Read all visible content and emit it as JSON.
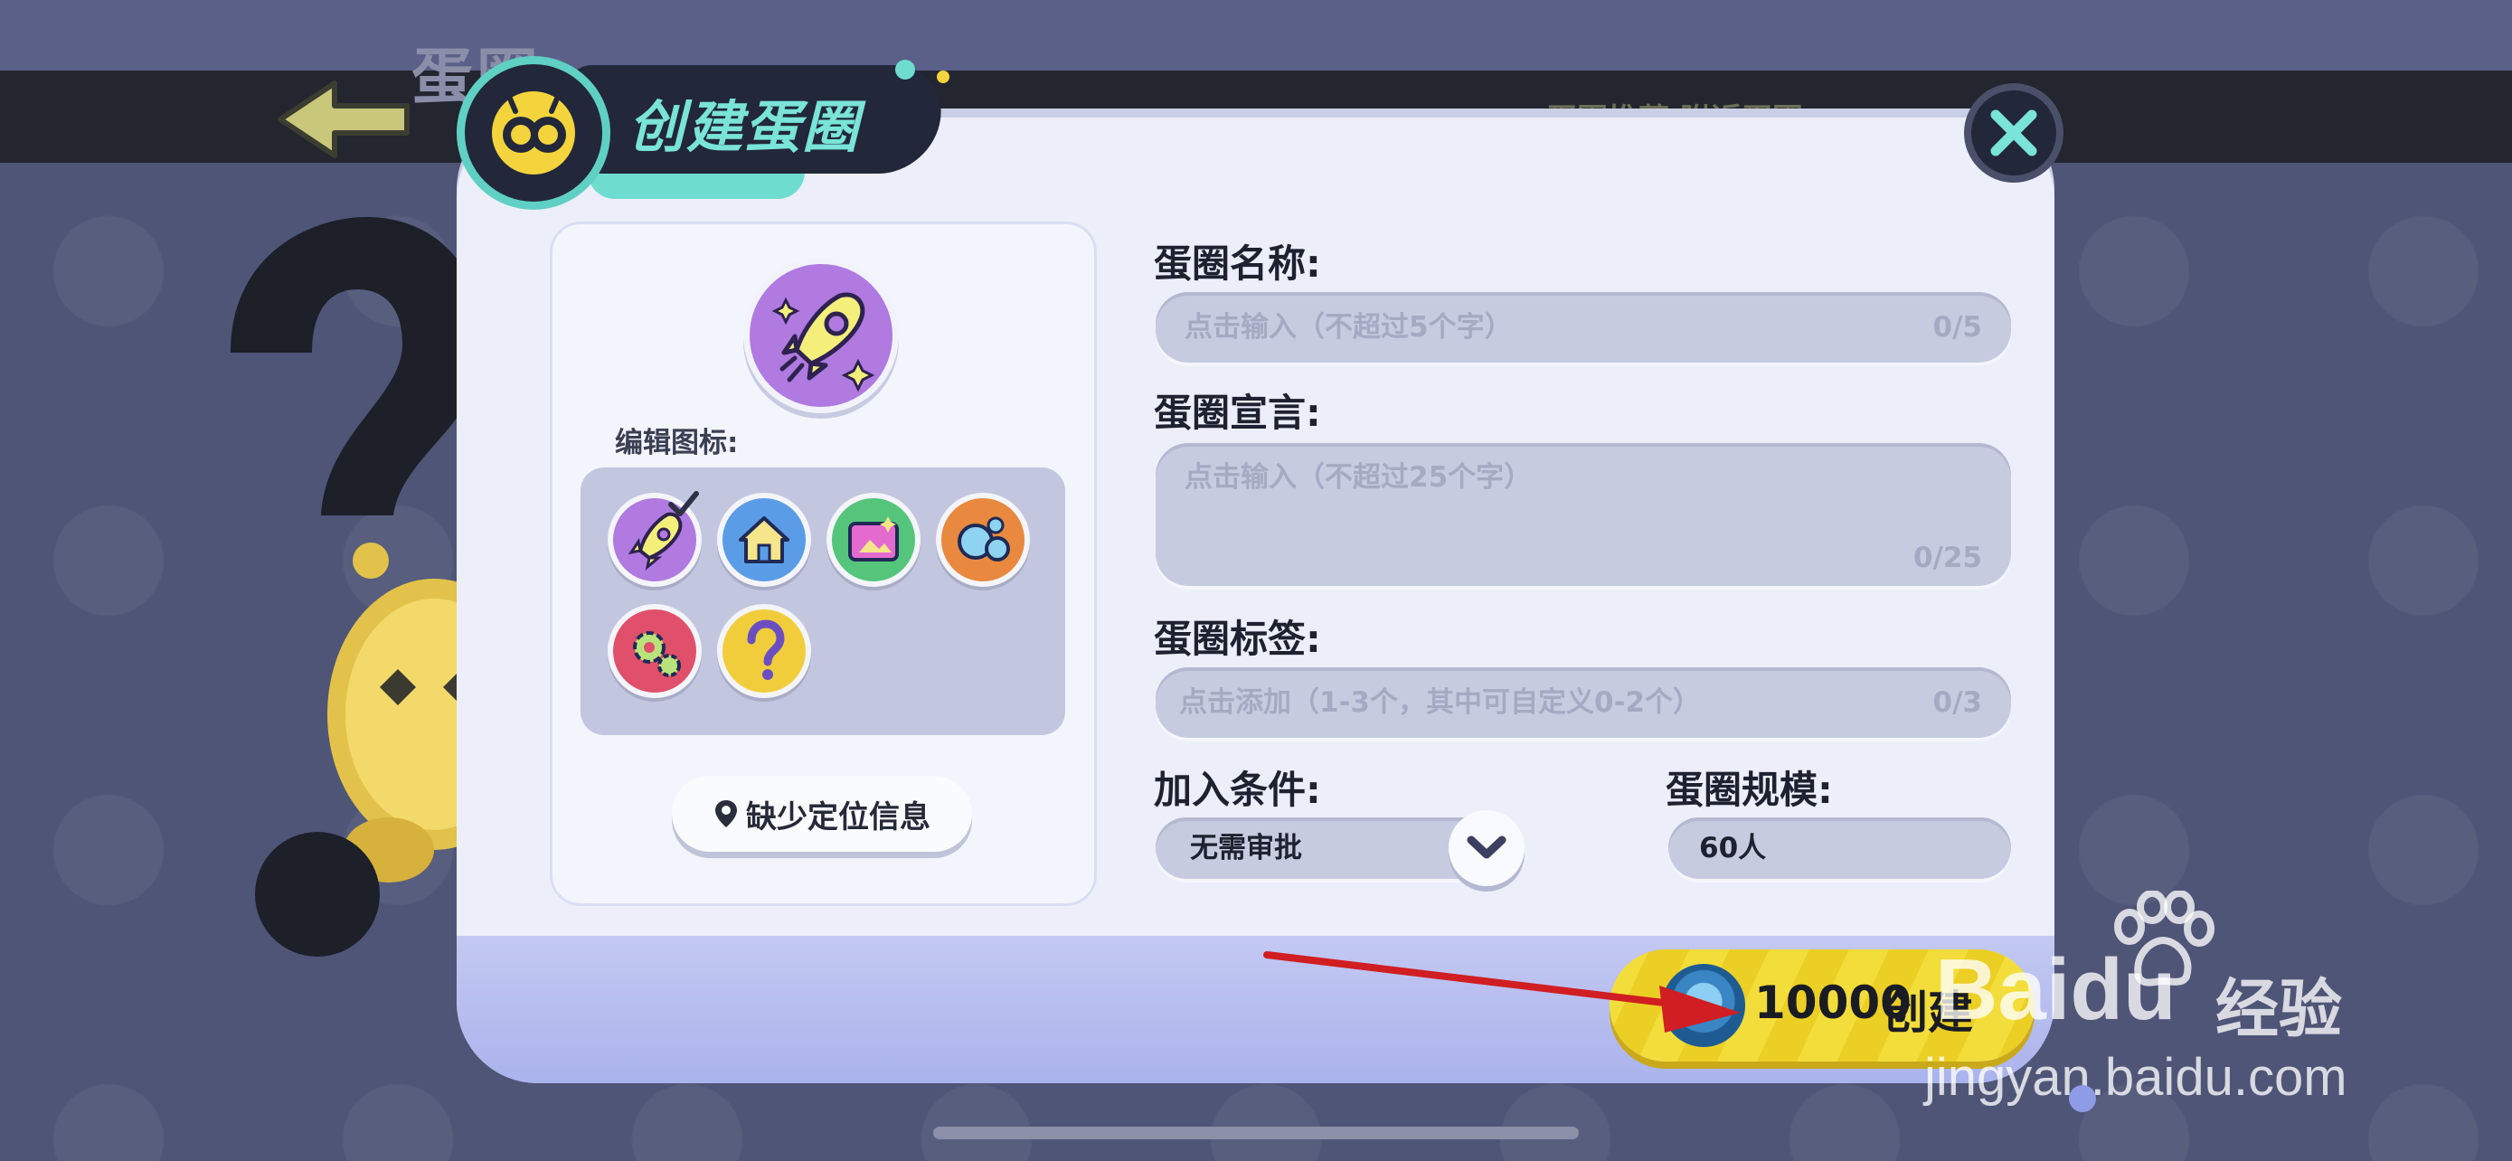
{
  "background": {
    "logo_text": "蛋圈",
    "ghost_tabs": "蛋圈推荐   附近蛋圈"
  },
  "dialog": {
    "title": "创建蛋圈",
    "edit_icon_label": "编辑图标:",
    "icon_options": [
      "rocket-icon",
      "house-icon",
      "photo-folder-icon",
      "bubbles-icon",
      "gears-icon",
      "question-icon"
    ],
    "selected_icon": "rocket-icon",
    "location_button": "缺少定位信息",
    "name": {
      "label": "蛋圈名称:",
      "placeholder": "点击输入（不超过5个字）",
      "counter": "0/5"
    },
    "declaration": {
      "label": "蛋圈宣言:",
      "placeholder": "点击输入（不超过25个字）",
      "counter": "0/25"
    },
    "tags": {
      "label": "蛋圈标签:",
      "placeholder": "点击添加（1-3个，其中可自定义0-2个）",
      "counter": "0/3"
    },
    "join_condition": {
      "label": "加入条件:",
      "value": "无需审批"
    },
    "scale": {
      "label": "蛋圈规模:",
      "value": "60人"
    },
    "create_button": {
      "cost": "10000",
      "label": "创建"
    }
  },
  "watermark": {
    "brand": "Baidu",
    "suffix": "经验",
    "url": "jingyan.baidu.com"
  },
  "colors": {
    "accent_teal": "#79e4d7",
    "button_yellow": "#f3dd3b",
    "dialog_bg": "#eceffa",
    "arrow_red": "#d01e22"
  }
}
